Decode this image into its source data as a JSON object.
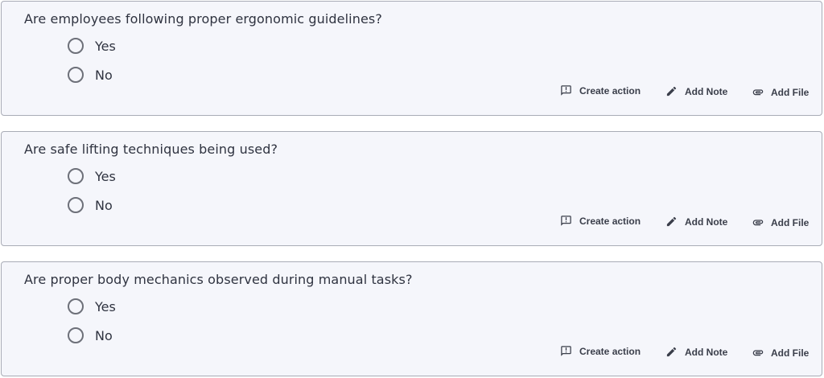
{
  "questions": [
    {
      "text": "Are employees following proper ergonomic guidelines?",
      "options": [
        {
          "label": "Yes",
          "selected": false
        },
        {
          "label": "No",
          "selected": false
        }
      ],
      "actions": {
        "create_action": {
          "label": "Create action",
          "icon": "feedback-icon"
        },
        "add_note": {
          "label": "Add Note",
          "icon": "pencil-icon"
        },
        "add_file": {
          "label": "Add File",
          "icon": "paperclip-icon"
        }
      }
    },
    {
      "text": "Are safe lifting techniques being used?",
      "options": [
        {
          "label": "Yes",
          "selected": false
        },
        {
          "label": "No",
          "selected": false
        }
      ],
      "actions": {
        "create_action": {
          "label": "Create action",
          "icon": "feedback-icon"
        },
        "add_note": {
          "label": "Add Note",
          "icon": "pencil-icon"
        },
        "add_file": {
          "label": "Add File",
          "icon": "paperclip-icon"
        }
      }
    },
    {
      "text": "Are proper body mechanics observed during manual tasks?",
      "options": [
        {
          "label": "Yes",
          "selected": false
        },
        {
          "label": "No",
          "selected": false
        }
      ],
      "actions": {
        "create_action": {
          "label": "Create action",
          "icon": "feedback-icon"
        },
        "add_note": {
          "label": "Add Note",
          "icon": "pencil-icon"
        },
        "add_file": {
          "label": "Add File",
          "icon": "paperclip-icon"
        }
      }
    }
  ],
  "colors": {
    "card_background": "#f5f6fb",
    "card_border": "#a9acb6",
    "text": "#2f3340",
    "radio_border": "#6d7079"
  }
}
